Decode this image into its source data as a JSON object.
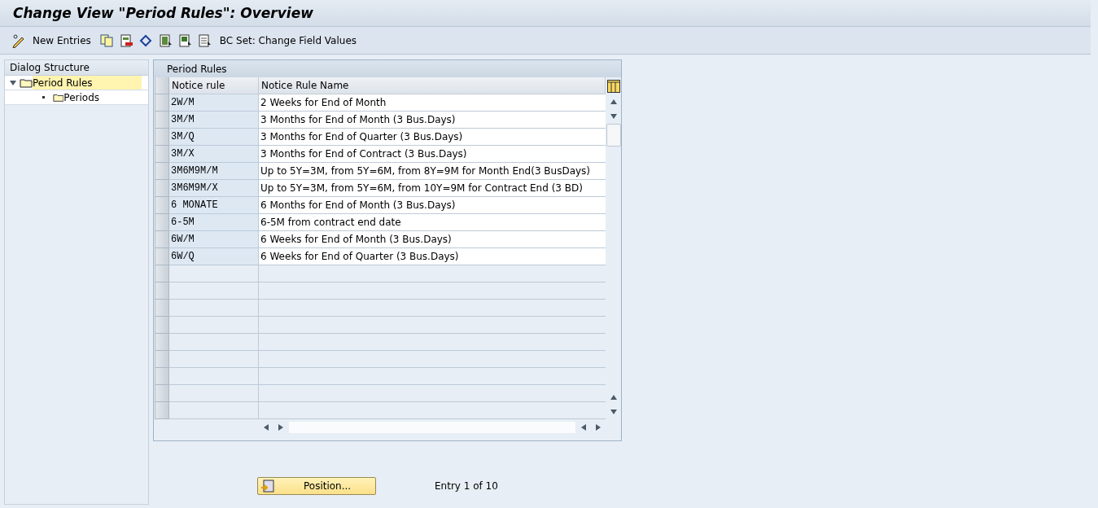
{
  "window": {
    "title": "Change View \"Period Rules\": Overview"
  },
  "toolbar": [
    {
      "kind": "button",
      "label": "New Entries"
    },
    {
      "kind": "icon"
    },
    {
      "kind": "icon"
    },
    {
      "kind": "icon"
    },
    {
      "kind": "icon"
    },
    {
      "kind": "icon"
    },
    {
      "kind": "icon"
    },
    {
      "kind": "button",
      "label": "BC Set: Change Field Values"
    }
  ],
  "dialog_structure": {
    "title": "Dialog Structure",
    "items": [
      {
        "label": "Period Rules",
        "selected": true,
        "expanded": true,
        "children": [
          {
            "label": "Periods",
            "selected": false
          }
        ]
      }
    ]
  },
  "table": {
    "title": "Period Rules",
    "columns": [
      "Notice rule",
      "Notice Rule Name"
    ],
    "rows": [
      {
        "rule": "2W/M",
        "name": "2 Weeks for End of Month"
      },
      {
        "rule": "3M/M",
        "name": "3 Months for End of Month (3 Bus.Days)"
      },
      {
        "rule": "3M/Q",
        "name": "3 Months for End of Quarter (3 Bus.Days)"
      },
      {
        "rule": "3M/X",
        "name": "3 Months for End of Contract (3 Bus.Days)"
      },
      {
        "rule": "3M6M9M/M",
        "name": "Up to 5Y=3M, from 5Y=6M, from 8Y=9M for Month End(3 BusDays)"
      },
      {
        "rule": "3M6M9M/X",
        "name": "Up to 5Y=3M, from 5Y=6M, from 10Y=9M for Contract End (3 BD)"
      },
      {
        "rule": "6 MONATE",
        "name": "6 Months for End of Month (3 Bus.Days)"
      },
      {
        "rule": "6-5M",
        "name": "6-5M from contract end date"
      },
      {
        "rule": "6W/M",
        "name": "6 Weeks for End of Month (3 Bus.Days)"
      },
      {
        "rule": "6W/Q",
        "name": "6 Weeks for End of Quarter (3 Bus.Days)"
      }
    ]
  },
  "footer": {
    "position_button": "Position...",
    "entry_info": "Entry 1 of 10"
  }
}
